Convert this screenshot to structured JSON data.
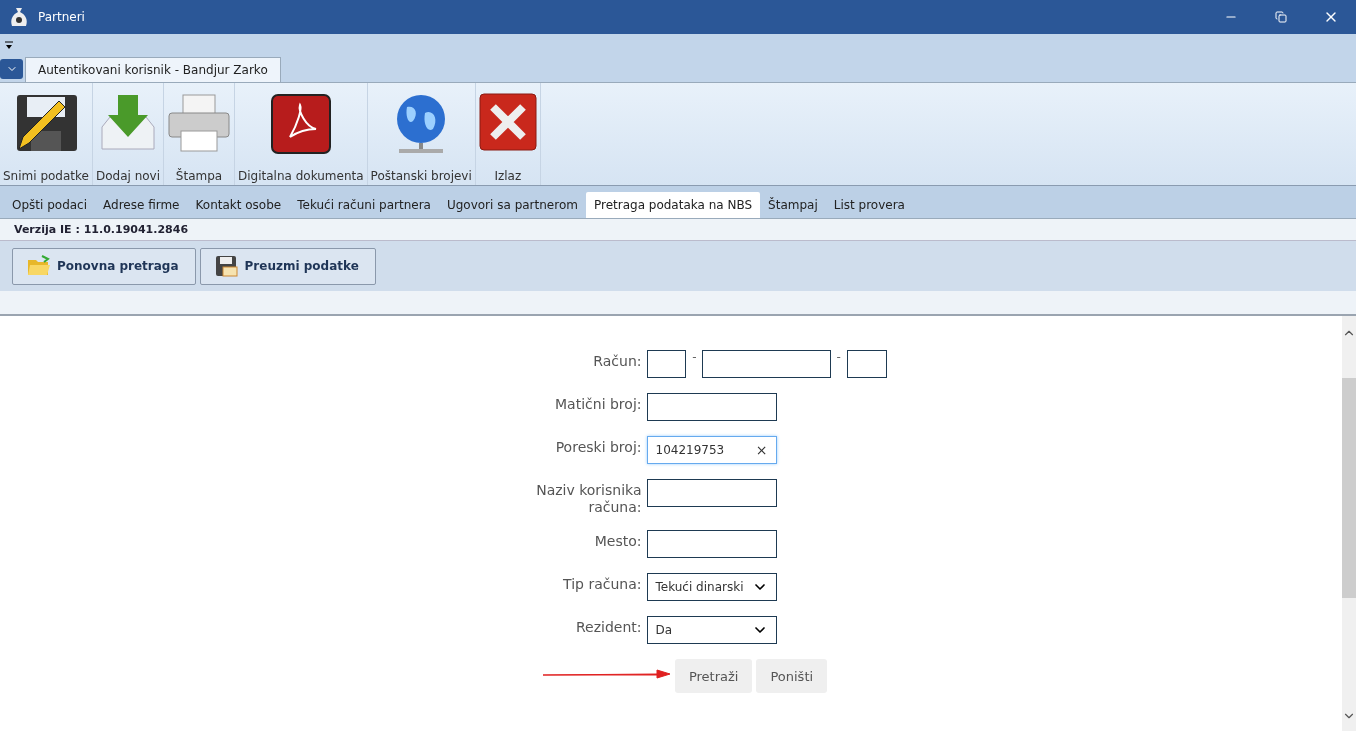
{
  "window": {
    "title": "Partneri"
  },
  "ribbon": {
    "tab": "Autentikovani korisnik - Bandjur Zarko",
    "buttons": [
      {
        "label": "Snimi podatke",
        "kind": "save"
      },
      {
        "label": "Dodaj novi",
        "kind": "add"
      },
      {
        "label": "Štampa",
        "kind": "print"
      },
      {
        "label": "Digitalna dokumenta",
        "kind": "pdf"
      },
      {
        "label": "Poštanski brojevi",
        "kind": "globe"
      },
      {
        "label": "Izlaz",
        "kind": "exit"
      }
    ]
  },
  "tabs": [
    {
      "label": "Opšti podaci",
      "selected": false
    },
    {
      "label": "Adrese firme",
      "selected": false
    },
    {
      "label": "Kontakt osobe",
      "selected": false
    },
    {
      "label": "Tekući računi partnera",
      "selected": false
    },
    {
      "label": "Ugovori sa partnerom",
      "selected": false
    },
    {
      "label": "Pretraga podataka na NBS",
      "selected": true
    },
    {
      "label": "Štampaj",
      "selected": false
    },
    {
      "label": "List provera",
      "selected": false
    }
  ],
  "version": "Verzija IE : 11.0.19041.2846",
  "toolbar": [
    {
      "label": "Ponovna pretraga",
      "kind": "folder"
    },
    {
      "label": "Preuzmi podatke",
      "kind": "disk"
    }
  ],
  "form": {
    "rows": [
      {
        "label": "Račun:",
        "kind": "account",
        "separators": [
          "-",
          "-"
        ]
      },
      {
        "label": "Matični broj:",
        "kind": "text"
      },
      {
        "label": "Poreski broj:",
        "kind": "text",
        "value": "104219753",
        "clear": "×",
        "focused": true
      },
      {
        "label": "Naziv korisnika računa:",
        "kind": "text"
      },
      {
        "label": "Mesto:",
        "kind": "text"
      },
      {
        "label": "Tip računa:",
        "kind": "select",
        "value": "Tekući dinarski"
      },
      {
        "label": "Rezident:",
        "kind": "select",
        "value": "Da"
      }
    ],
    "buttons": [
      "Pretraži",
      "Poništi"
    ]
  }
}
